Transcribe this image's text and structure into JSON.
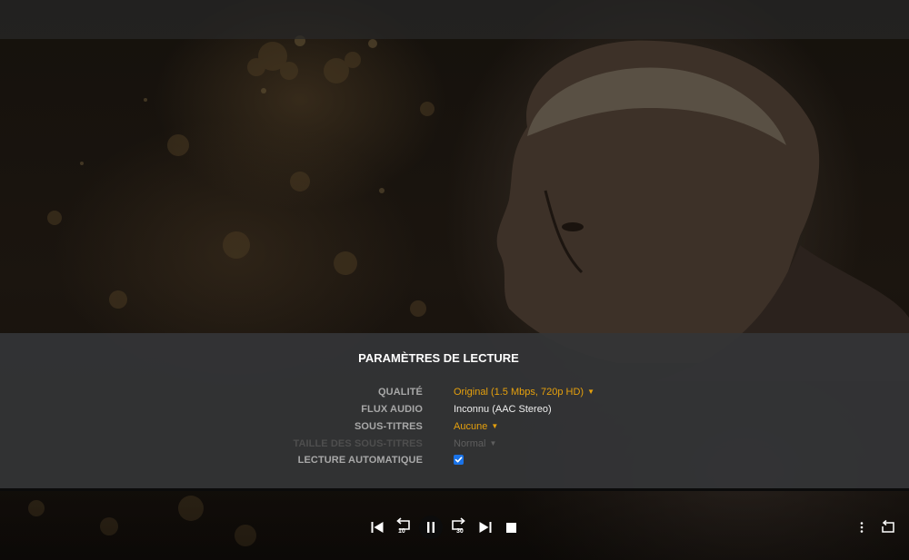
{
  "panel": {
    "title": "PARAMÈTRES DE LECTURE",
    "rows": [
      {
        "label": "QUALITÉ",
        "value": "Original (1.5 Mbps, 720p HD)",
        "dropdown": true,
        "enabled": true
      },
      {
        "label": "FLUX AUDIO",
        "value": "Inconnu (AAC Stereo)",
        "dropdown": false,
        "enabled": true
      },
      {
        "label": "SOUS-TITRES",
        "value": "Aucune",
        "dropdown": true,
        "enabled": true
      },
      {
        "label": "TAILLE DES SOUS-TITRES",
        "value": "Normal",
        "dropdown": true,
        "enabled": false
      },
      {
        "label": "LECTURE AUTOMATIQUE",
        "checked": true
      }
    ]
  },
  "controls": {
    "skip_back_seconds": "10",
    "skip_forward_seconds": "30",
    "icons": [
      "skip-previous-icon",
      "replay-10-icon",
      "pause-icon",
      "forward-30-icon",
      "skip-next-icon",
      "stop-icon",
      "more-vertical-icon",
      "repeat-icon"
    ]
  },
  "colors": {
    "accent": "#e5a00d",
    "checkbox": "#1a73e8",
    "panel": "#343537"
  }
}
